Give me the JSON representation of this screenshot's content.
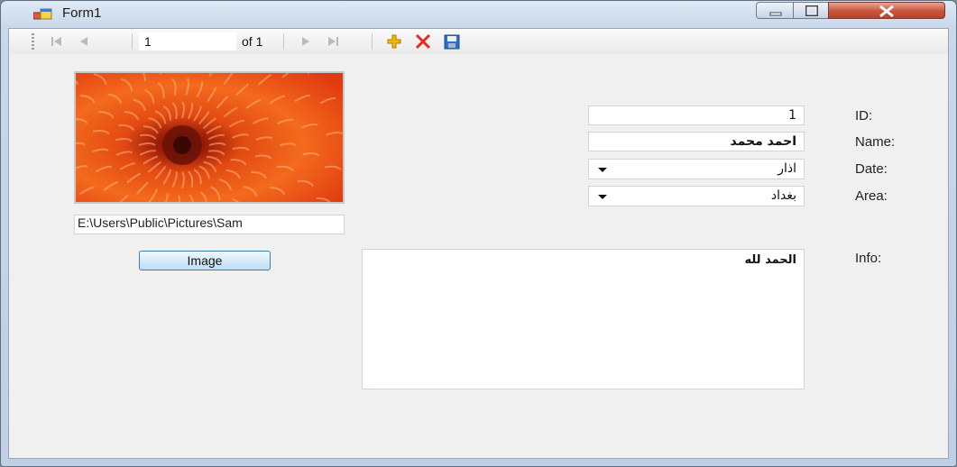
{
  "window": {
    "title": "Form1"
  },
  "navigator": {
    "position": "1",
    "count_label": "of 1",
    "icons": [
      "move-first-icon",
      "move-previous-icon",
      "move-next-icon",
      "move-last-icon",
      "add-new-icon",
      "delete-icon",
      "save-icon"
    ]
  },
  "image_panel": {
    "path": "E:\\Users\\Public\\Pictures\\Sam",
    "button_label": "Image"
  },
  "form": {
    "id_label": "ID:",
    "id_value": "1",
    "name_label": "Name:",
    "name_value": "احمد محمد",
    "date_label": "Date:",
    "date_value": "اذار",
    "area_label": "Area:",
    "area_value": "بغداد",
    "info_label": "Info:",
    "info_value": "الحمد لله"
  },
  "colors": {
    "add": "#f5b800",
    "delete": "#e8291c",
    "save": "#2f6fc0",
    "button_border": "#3c7fb1"
  }
}
